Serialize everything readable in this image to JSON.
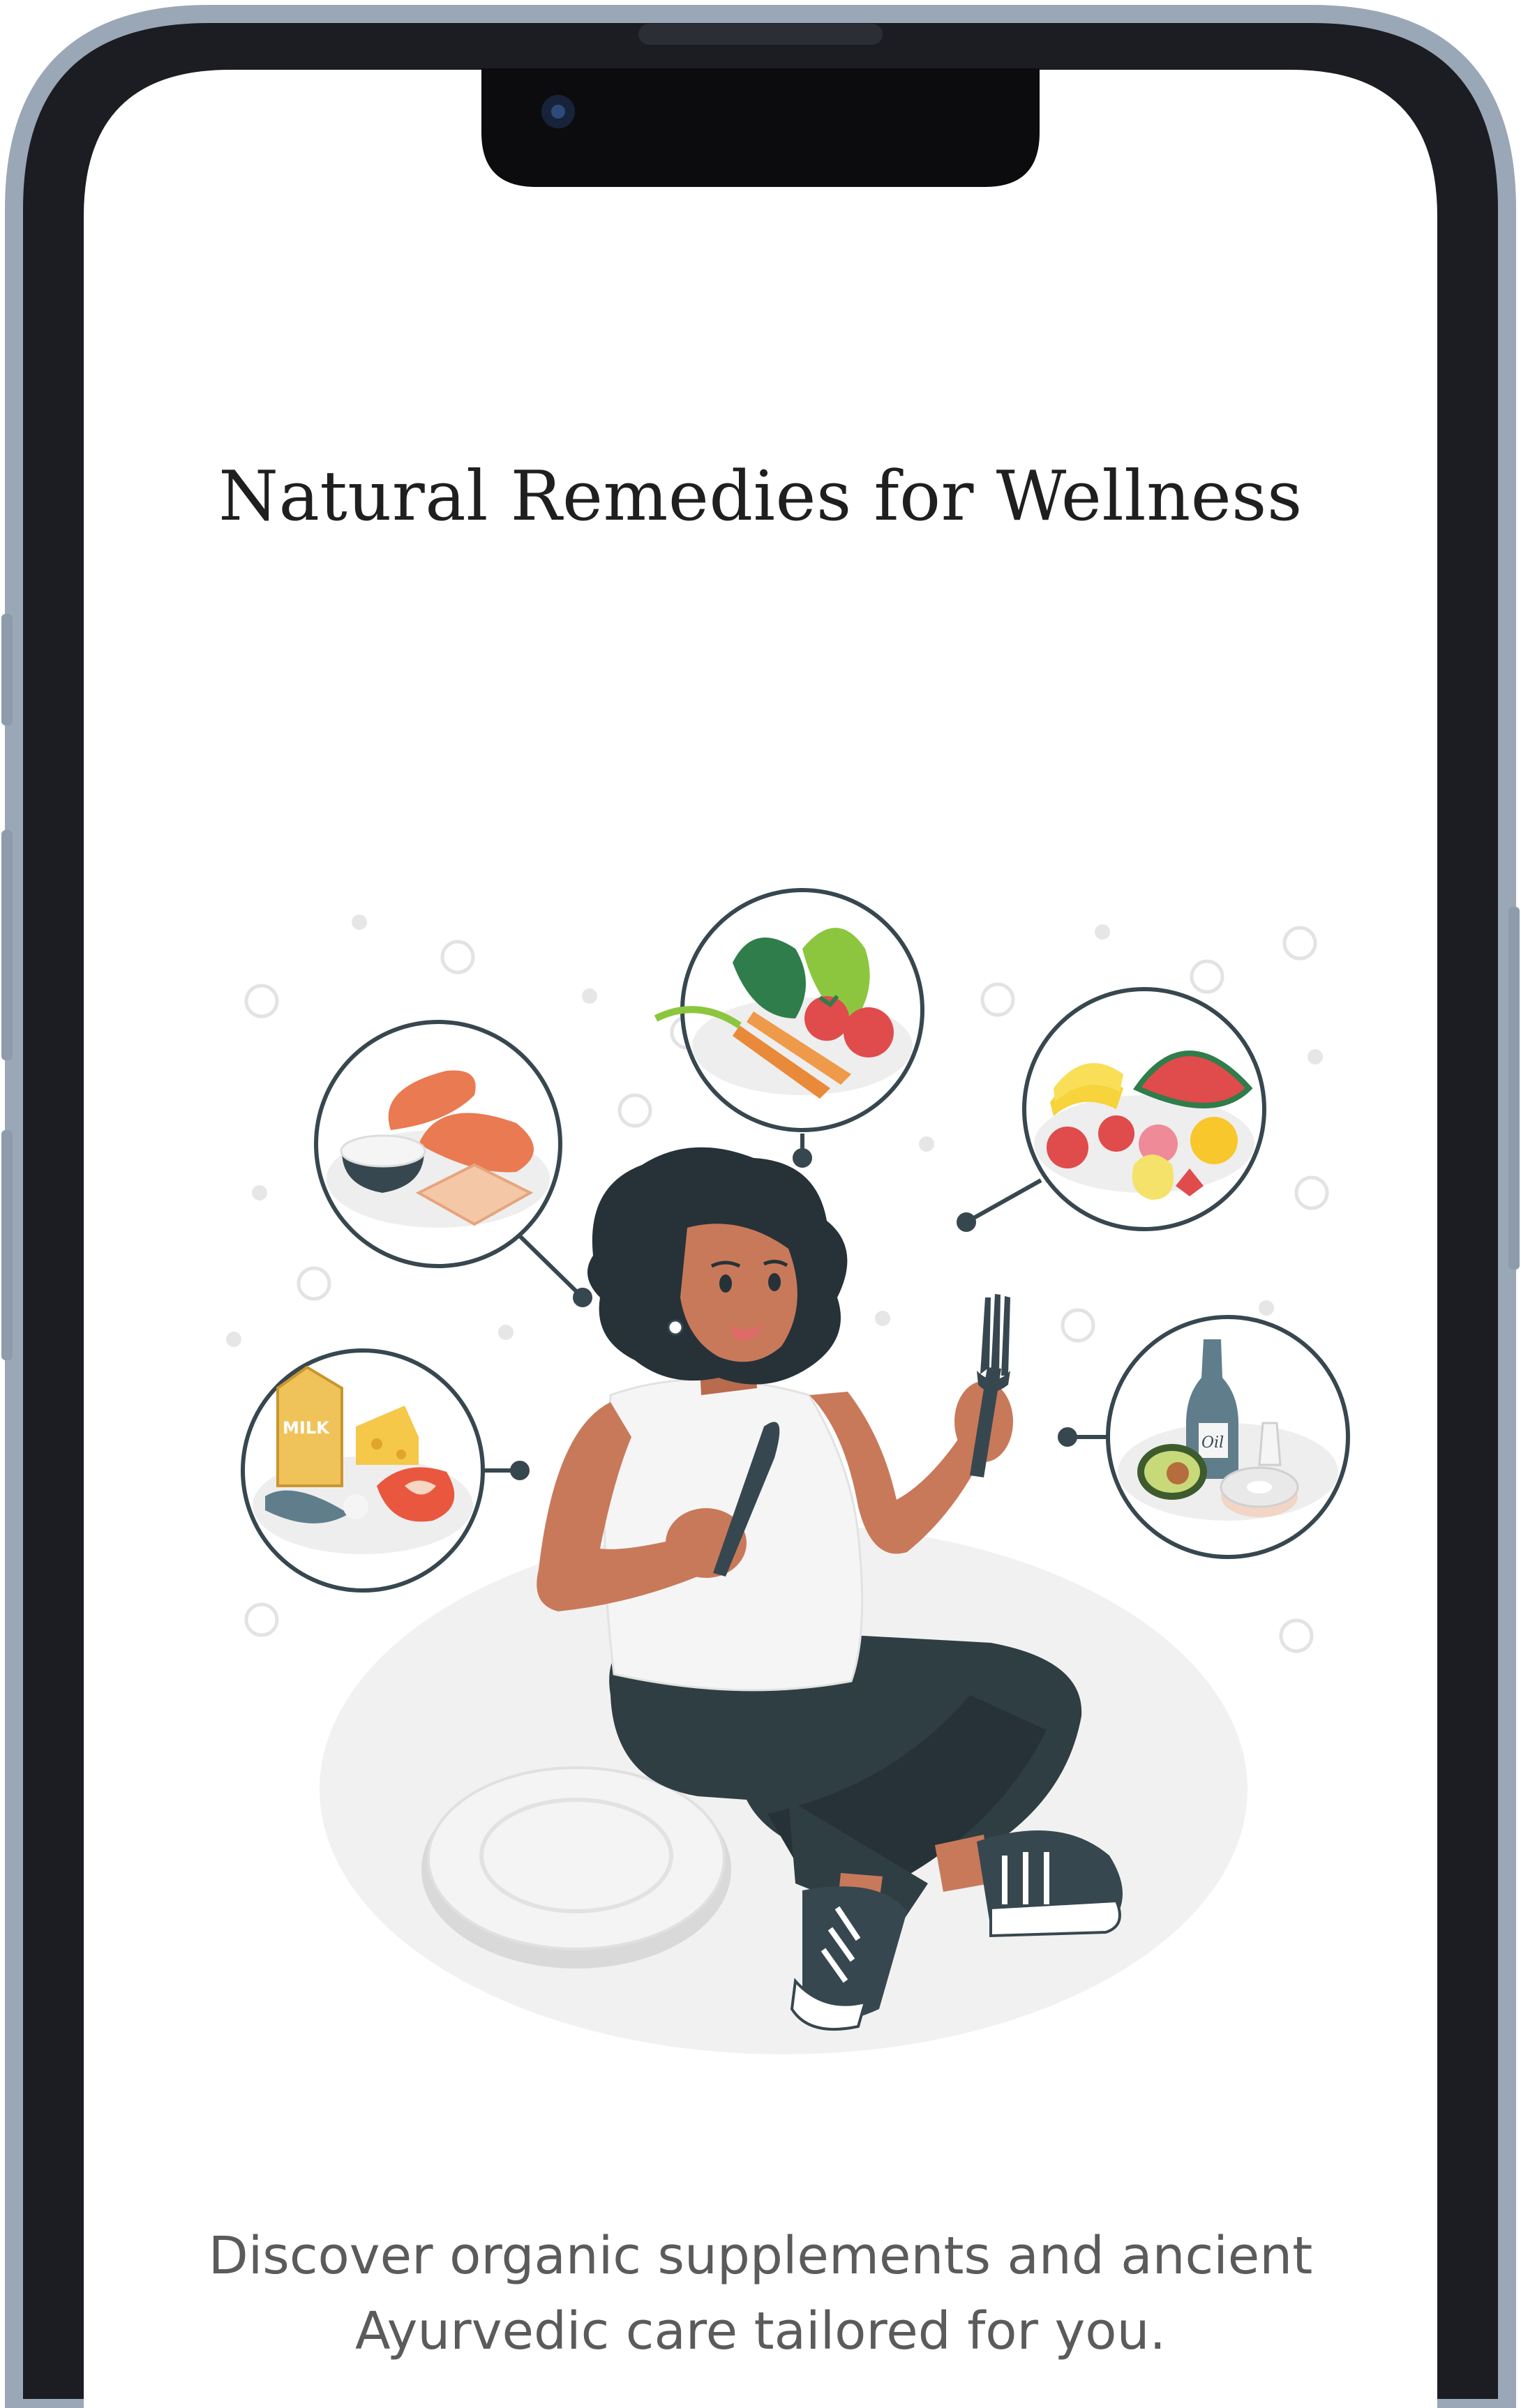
{
  "screen": {
    "title": "Natural Remedies for Wellness",
    "subtitle_line1": "Discover organic supplements and ancient",
    "subtitle_line2": "Ayurvedic care tailored for you."
  },
  "illustration": {
    "figure": "woman-sitting-with-fork-and-knife",
    "food_groups": [
      "grains-and-bread",
      "vegetables",
      "fruits",
      "dairy-meat-fish",
      "oils-and-fats"
    ],
    "carton_label": "MILK",
    "bottle_label": "Oil"
  },
  "colors": {
    "frame": "#9aa7b6",
    "screen_bg": "#ffffff",
    "ink": "#263238",
    "skin": "#c8795a",
    "accent_red": "#e04b4b"
  }
}
